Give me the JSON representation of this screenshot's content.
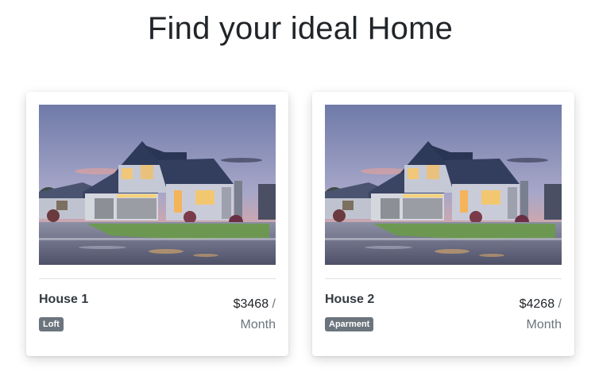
{
  "page": {
    "title": "Find your ideal Home"
  },
  "listings": [
    {
      "name": "House 1",
      "type": "Loft",
      "price": "$3468",
      "separator": "/",
      "period": "Month"
    },
    {
      "name": "House 2",
      "type": "Aparment",
      "price": "$4268",
      "separator": "/",
      "period": "Month"
    }
  ],
  "colors": {
    "badge": "#6c757d",
    "divider": "#dee2e6",
    "text_muted": "#6c757d"
  }
}
